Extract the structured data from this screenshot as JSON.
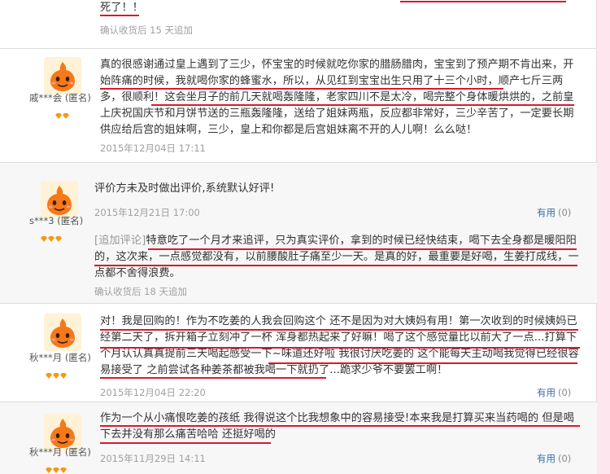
{
  "review_top": {
    "content_tail": "死了！！",
    "footnote": "确认收货后 15 天追加"
  },
  "reviews": [
    {
      "user": "戚***会 (匿名)",
      "avatar_icon": "orange-mascot-avatar",
      "gem_count": 3,
      "content": "真的很感谢通过皇上遇到了三少，怀宝宝的时候就吃你家的腊肠腊肉，宝宝到了预产期不肯出来，开始阵痛的时候，我就喝你家的蜂蜜水，所以，从见红到宝宝出生只用了十三个小时，顺产七斤三两多，很顺利！这会坐月子的前几天就喝轰隆隆，老家四川不是太冷，喝完整个身体暖烘烘的，之前皇上庆祝国庆节和月饼节送的三瓶轰隆隆，送给了姐妹两瓶，反应都非常好，三少辛苦了，一定要长期供应给后宫的姐妹啊，三少，皇上和你都是后宫姐妹离不开的人儿啊！么么哒！",
      "date": "2015年12月04日 17:11"
    },
    {
      "user": "s***3 (匿名)",
      "avatar_icon": "orange-mascot-avatar",
      "gem_count": 3,
      "content": "评价方未及时做出评价,系统默认好评!",
      "date": "2015年12月21日 17:00",
      "useful_label": "有用",
      "useful_count": "(0)",
      "append_tag": "[追加评论]",
      "append_content": "特意吃了一个月才来追评，只为真实评价，拿到的时候已经快结束，喝下去全身都是暖阳阳的，这次来，一点感觉都没有，以前腰酸肚子痛至少一天。是真的好，最重要是好喝，生姜打成线，一点都不舍得浪费。",
      "append_footnote": "确认收货后 18 天追加"
    },
    {
      "user": "秋***月 (匿名)",
      "avatar_icon": "orange-mascot-avatar",
      "gem_count": 3,
      "content": "对！我是回购的！作为不吃姜的人我会回购这个 还不是因为对大姨妈有用！第一次收到的时候姨妈已经第二天了，拆开箱子立刻冲了一杯 浑身都热起来了好嘛！喝了这个感觉量比以前大了一点...打算下个月认认真真提前三天喝起感受一下~味道还好啦 我很讨厌吃姜的 这个能每天主动喝我觉得已经很容易接受了 之前尝试各种姜茶都被我喝一下就扔了...跪求少爷不要罢工啊！",
      "date": "2015年12月04日 22:20",
      "useful_label": "有用",
      "useful_count": "(0)"
    },
    {
      "user": "秋***月 (匿名)",
      "avatar_icon": "orange-mascot-avatar",
      "gem_count": 3,
      "content": "作为一个从小痛恨吃姜的孩纸 我得说这个比我想象中的容易接受!本来我是打算买来当药喝的 但是喝下去并没有那么痛苦哈哈 还挺好喝的",
      "date": "2015年11月29日 14:11",
      "useful_label": "有用",
      "useful_count": "(0)"
    }
  ]
}
